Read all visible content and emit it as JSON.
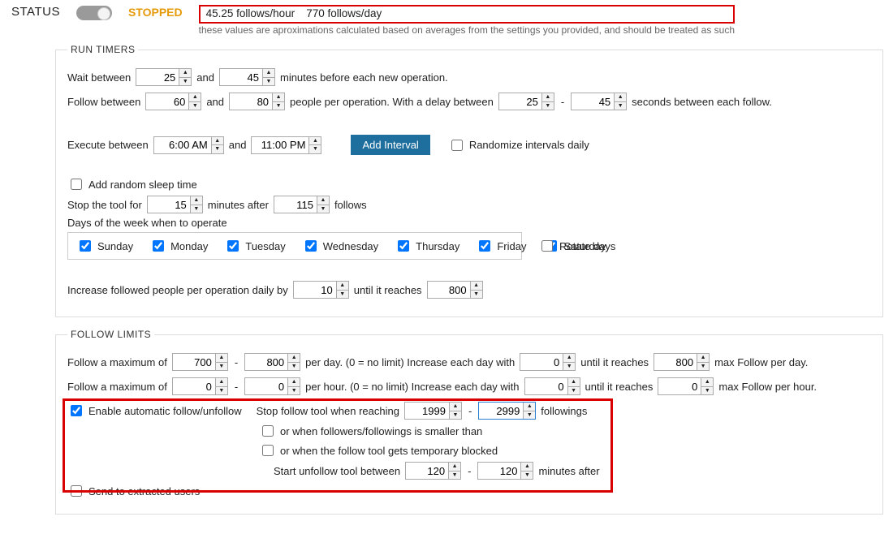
{
  "status": {
    "label": "STATUS",
    "state": "STOPPED",
    "rate_hour": "45.25  follows/hour",
    "rate_day": "770  follows/day",
    "note": "these values are aproximations calculated based on averages from the settings you provided, and should be treated as such"
  },
  "run_timers": {
    "legend": "RUN TIMERS",
    "wait_between_label": "Wait between",
    "wait_min": "25",
    "and": "and",
    "wait_max": "45",
    "wait_tail": "minutes before each new operation.",
    "follow_between_label": "Follow between",
    "follow_min": "60",
    "follow_max": "80",
    "follow_mid": "people per operation.  With a delay between",
    "delay_min": "25",
    "dash": "-",
    "delay_max": "45",
    "follow_tail": "seconds between each follow.",
    "exec_label": "Execute between",
    "exec_from": "6:00 AM",
    "exec_to": "11:00 PM",
    "add_interval": "Add Interval",
    "randomize": "Randomize intervals daily",
    "add_sleep": "Add random sleep time",
    "stop_tool_label": "Stop the tool for",
    "stop_tool_value": "15",
    "stop_tool_mid": "minutes after",
    "stop_tool_after": "115",
    "stop_tool_tail": "follows",
    "days_label": "Days of the week when to operate",
    "days": {
      "sun": "Sunday",
      "mon": "Monday",
      "tue": "Tuesday",
      "wed": "Wednesday",
      "thu": "Thursday",
      "fri": "Friday",
      "sat": "Saturday"
    },
    "rotate_days": "Rotate days",
    "increase_label": "Increase followed people per operation daily by",
    "increase_by": "10",
    "until_reaches": "until it reaches",
    "increase_limit": "800"
  },
  "follow_limits": {
    "legend": "FOLLOW LIMITS",
    "max_label": "Follow a maximum of",
    "day_min": "700",
    "day_max": "800",
    "per_day": "per day. (0 = no limit)   Increase each day with",
    "day_inc": "0",
    "until": "until it reaches",
    "day_reach": "800",
    "day_tail": "max Follow per day.",
    "hour_min": "0",
    "hour_max": "0",
    "per_hour": "per hour. (0 = no limit)   Increase each day with",
    "hour_inc": "0",
    "hour_reach": "0",
    "hour_tail": "max Follow per hour.",
    "enable_auto": "Enable automatic follow/unfollow",
    "stop_when": "Stop follow tool when  reaching",
    "stop_lo": "1999",
    "stop_hi": "2999",
    "followings": "followings",
    "or_ratio": "or when followers/followings is smaller than",
    "or_blocked": "or when the follow tool gets temporary blocked",
    "start_unfollow": "Start unfollow tool between",
    "uf_lo": "120",
    "uf_hi": "120",
    "min_after": "minutes after",
    "send_extracted": "Send to extracted users"
  }
}
